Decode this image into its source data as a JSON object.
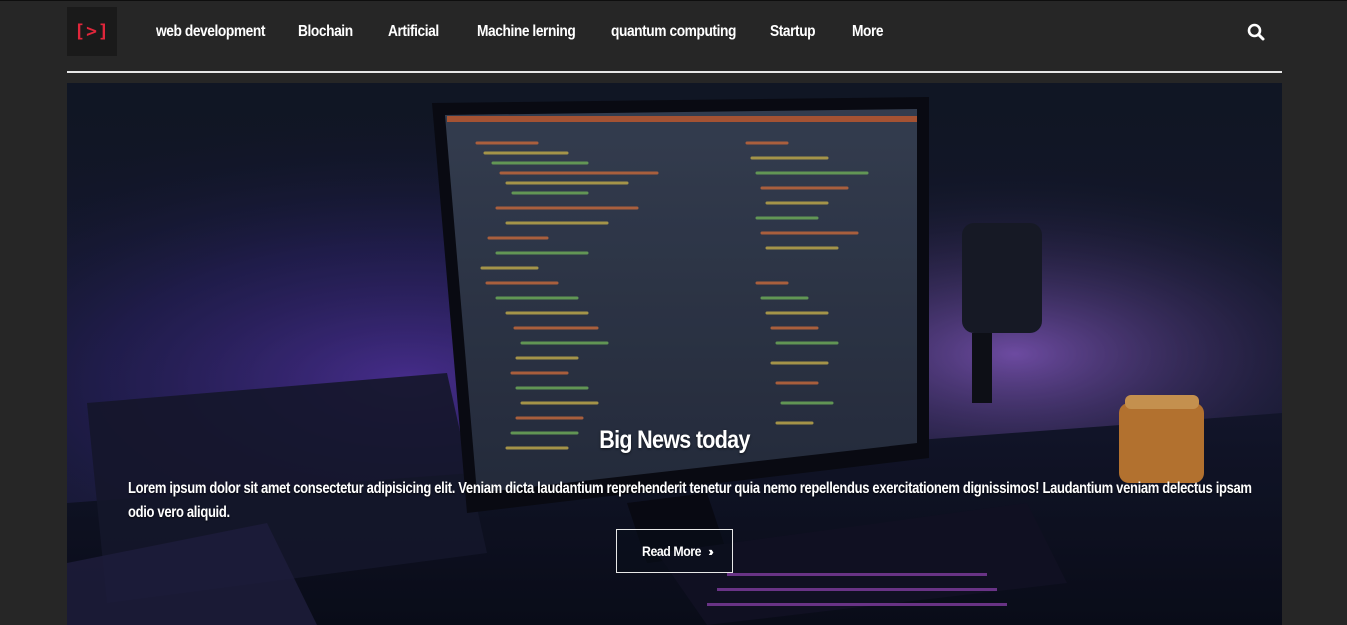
{
  "brand": {
    "logo_text": "[>]",
    "logo_color": "#e0263b"
  },
  "nav": {
    "items": [
      {
        "label": "web development"
      },
      {
        "label": "Blochain"
      },
      {
        "label": "Artificial"
      },
      {
        "label": "Machine lerning"
      },
      {
        "label": "quantum computing"
      },
      {
        "label": "Startup"
      },
      {
        "label": "More"
      }
    ],
    "search_icon": "search-icon"
  },
  "hero": {
    "title": "Big News today",
    "text": "Lorem ipsum dolor sit amet consectetur adipisicing elit. Veniam dicta laudantium reprehenderit tenetur quia nemo repellendus exercitationem dignissimos! Laudantium veniam delectus ipsam odio vero aliquid.",
    "button_label": "Read More",
    "button_icon": "double-chevron-right-icon"
  },
  "colors": {
    "page_bg": "#262626",
    "text": "#ffffff",
    "accent": "#e0263b"
  }
}
